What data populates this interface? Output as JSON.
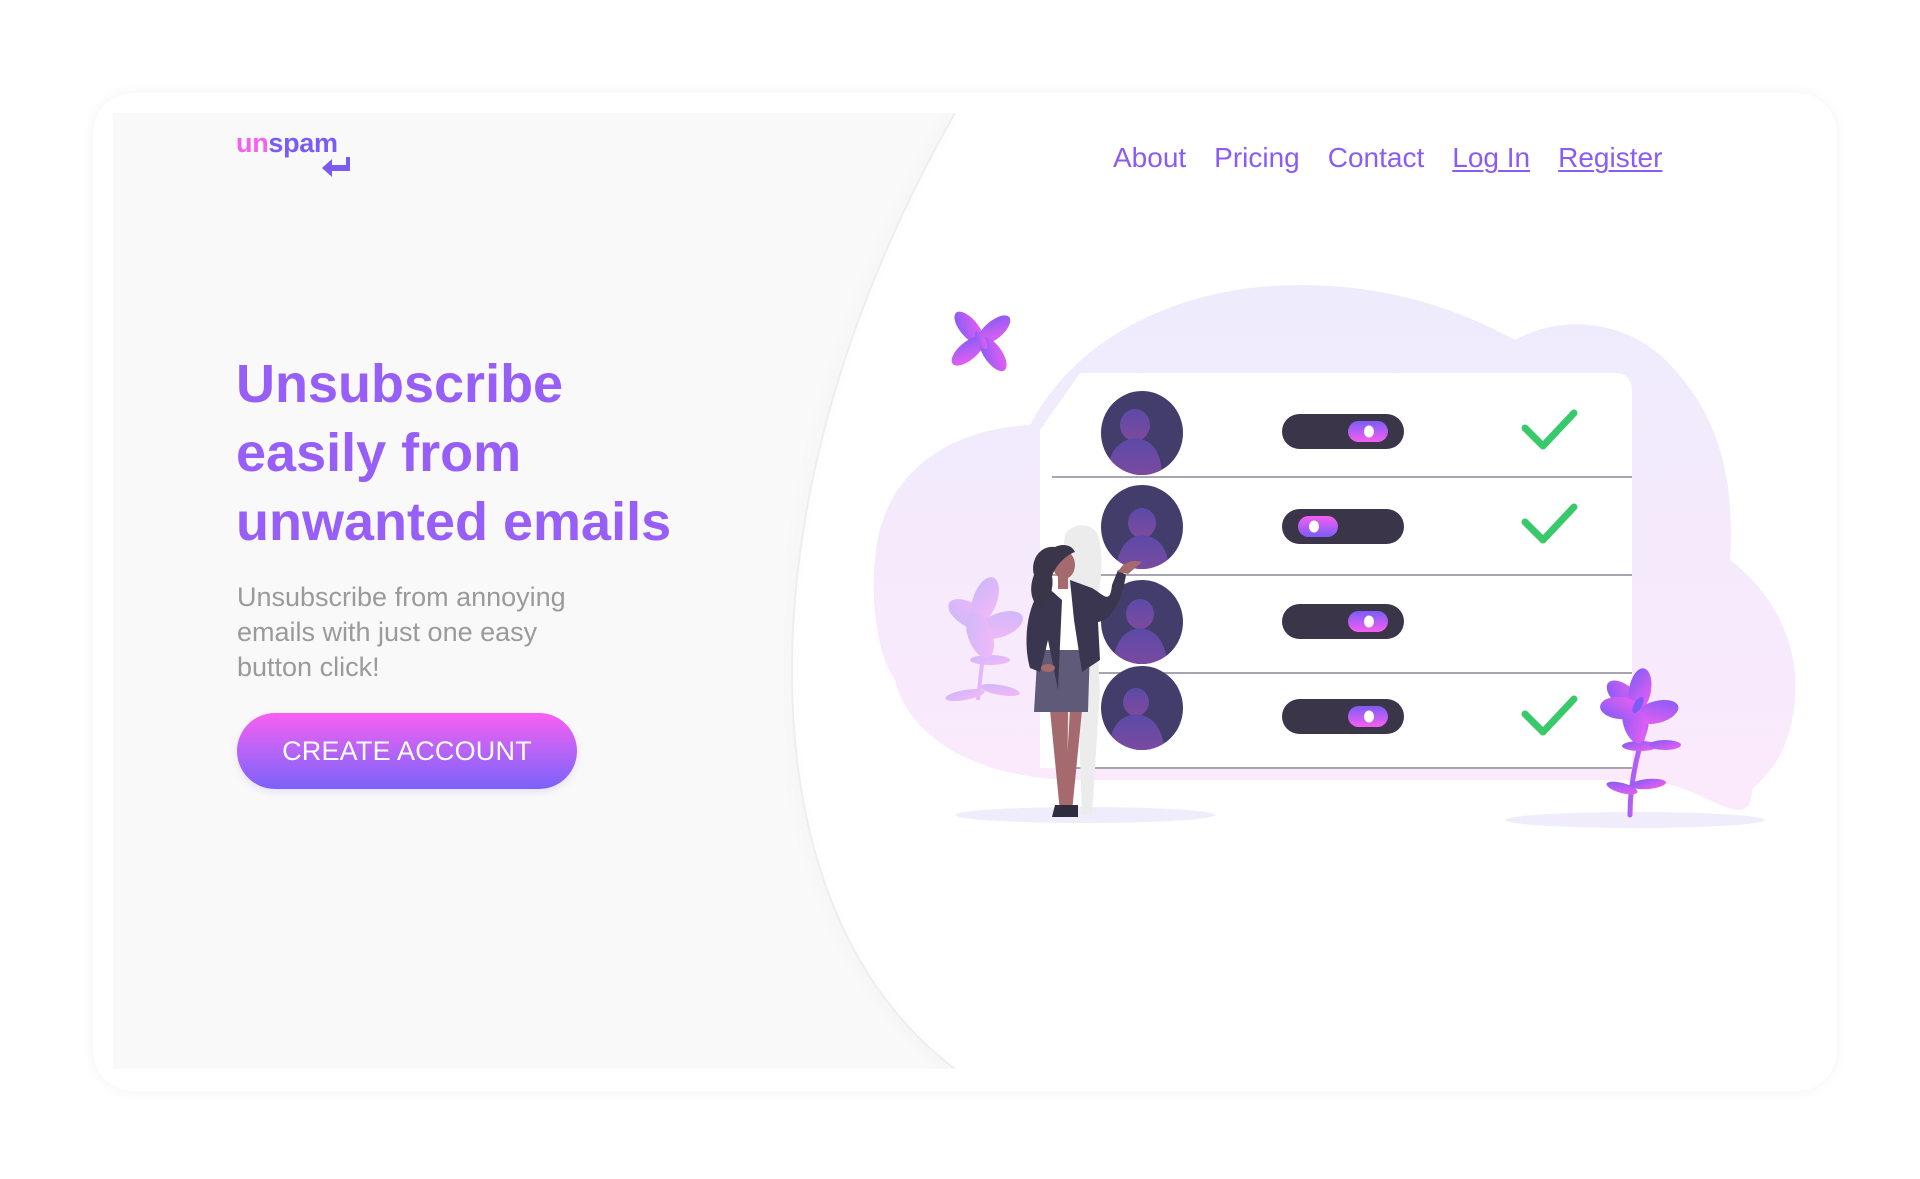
{
  "brand": {
    "logo_part1": "un",
    "logo_part2": "spam",
    "logo_icon": "return-arrow-icon",
    "pink": "#f85ff0",
    "purple": "#7a5cf5"
  },
  "nav": {
    "items": [
      {
        "label": "About",
        "underlined": false
      },
      {
        "label": "Pricing",
        "underlined": false
      },
      {
        "label": "Contact",
        "underlined": false
      },
      {
        "label": "Log In",
        "underlined": true
      },
      {
        "label": "Register",
        "underlined": true
      }
    ],
    "color": "#8a5cf5"
  },
  "hero": {
    "headline_lines": [
      "Unsubscribe",
      "easily from",
      "unwanted emails"
    ],
    "subtext_lines": [
      "Unsubscribe from annoying",
      "emails with just one easy",
      "button click!"
    ],
    "cta_label": "CREATE ACCOUNT",
    "headline_color": "#975ff8",
    "subtext_color": "#9a9a9a"
  },
  "illustration": {
    "rows": [
      {
        "toggle_on": true,
        "checked": true
      },
      {
        "toggle_on": false,
        "checked": true
      },
      {
        "toggle_on": true,
        "checked": false
      },
      {
        "toggle_on": true,
        "checked": true
      }
    ],
    "check_color": "#38c96a",
    "avatar_color": "#423d6b",
    "toggle_track_color": "#3a3548"
  }
}
